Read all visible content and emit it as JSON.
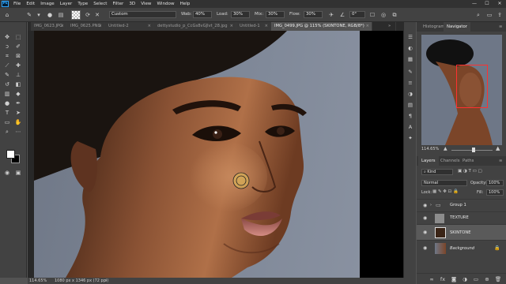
{
  "app": {
    "logo_text": "Ps"
  },
  "menu": [
    "File",
    "Edit",
    "Image",
    "Layer",
    "Type",
    "Select",
    "Filter",
    "3D",
    "View",
    "Window",
    "Help"
  ],
  "window_controls": {
    "minimize": "—",
    "maximize": "☐",
    "close": "✕"
  },
  "options": {
    "mode_value": "Custom",
    "wab_label": "Wab:",
    "wab_value": "40%",
    "load_label": "Load:",
    "load_value": "30%",
    "mix_label": "Mix:",
    "mix_value": "30%",
    "flow_label": "Flow:",
    "flow_value": "30%",
    "angle_value": "0°"
  },
  "tabs": [
    {
      "label": "IMG_0623.JPG",
      "active": false
    },
    {
      "label": "IMG_0625.PNG",
      "active": false
    },
    {
      "label": "Untitled-2",
      "active": false
    },
    {
      "label": "dettystudio_p_CcGs8vGJlvt_28.jpg",
      "active": false
    },
    {
      "label": "Untitled-1",
      "active": false
    },
    {
      "label": "IMG_0499.JPG @ 115% (SKINTONE, RGB/8*)",
      "active": true
    }
  ],
  "tab_close": "×",
  "status": {
    "zoom": "114.65%",
    "doc_info": "1080 px x 1346 px (72 ppi)"
  },
  "panels": {
    "top_tabs": [
      "Histogram",
      "Navigator"
    ],
    "nav_zoom": "114.65%",
    "layer_tabs": [
      "Layers",
      "Channels",
      "Paths"
    ],
    "kind_label": "Kind",
    "blend_mode": "Normal",
    "opacity_label": "Opacity:",
    "opacity_value": "100%",
    "lock_label": "Lock:",
    "fill_label": "Fill:",
    "fill_value": "100%",
    "layers": [
      {
        "name": "Group 1",
        "type": "group",
        "selected": false
      },
      {
        "name": "TEXTURE",
        "type": "layer",
        "selected": false
      },
      {
        "name": "SKINTONE",
        "type": "layer",
        "selected": true
      },
      {
        "name": "Background",
        "type": "background",
        "selected": false
      }
    ]
  },
  "icons": {
    "eye": "eye-icon",
    "lock": "lock-icon",
    "folder": "folder-icon"
  },
  "colors": {
    "accent": "#31a8ff",
    "nav_frame": "#ff3030",
    "brush_cursor": "#e2c15a",
    "foreground": "#ffffff",
    "background": "#000000"
  }
}
